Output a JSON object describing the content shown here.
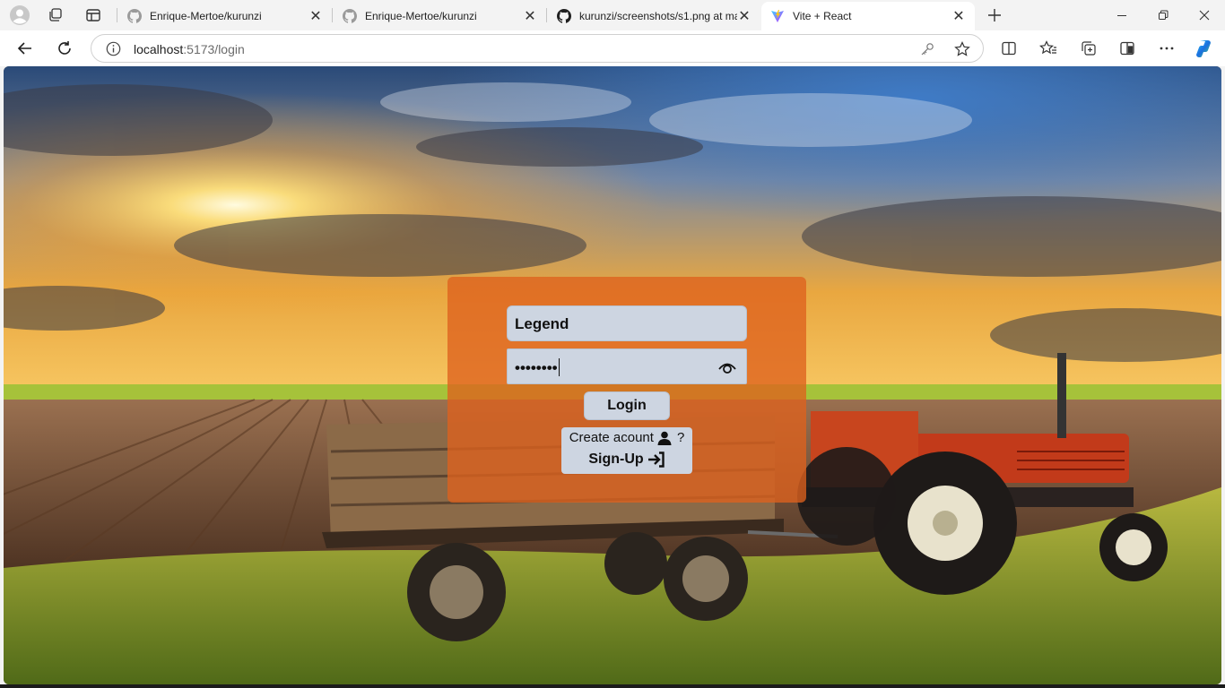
{
  "browser": {
    "tabs": [
      {
        "title": "Enrique-Mertoe/kurunzi",
        "icon": "github-icon"
      },
      {
        "title": "Enrique-Mertoe/kurunzi",
        "icon": "github-icon"
      },
      {
        "title": "kurunzi/screenshots/s1.png at ma",
        "icon": "github-icon"
      },
      {
        "title": "Vite + React",
        "icon": "vite-icon",
        "active": true
      }
    ],
    "url_host": "localhost",
    "url_path": ":5173/login"
  },
  "login": {
    "username_value": "Legend",
    "password_value": "••••••••",
    "login_label": "Login",
    "create_account_text": "Create acount",
    "create_account_suffix": "?",
    "signup_label": "Sign-Up"
  },
  "colors": {
    "card": "#de621e",
    "field": "#cdd5e1",
    "accent_edge": "#0078d4"
  }
}
